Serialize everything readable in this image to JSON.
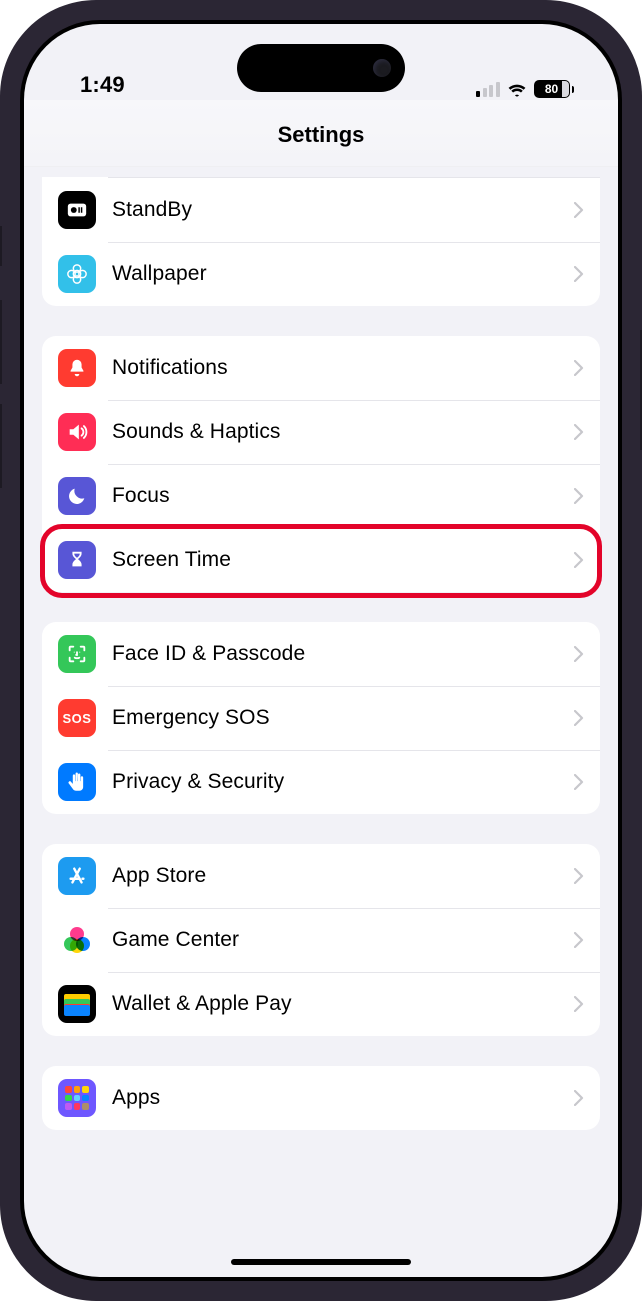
{
  "status": {
    "time": "1:49",
    "battery_pct": "80"
  },
  "nav": {
    "title": "Settings"
  },
  "groups": [
    {
      "id": "g0",
      "partial_top": true,
      "rows": [
        {
          "icon": "standby",
          "label": "StandBy"
        },
        {
          "icon": "wallpaper",
          "label": "Wallpaper"
        }
      ]
    },
    {
      "id": "g1",
      "rows": [
        {
          "icon": "notif",
          "label": "Notifications"
        },
        {
          "icon": "sounds",
          "label": "Sounds & Haptics"
        },
        {
          "icon": "focus",
          "label": "Focus"
        },
        {
          "icon": "screentime",
          "label": "Screen Time",
          "highlight": true
        }
      ]
    },
    {
      "id": "g2",
      "rows": [
        {
          "icon": "faceid",
          "label": "Face ID & Passcode"
        },
        {
          "icon": "sos",
          "label": "Emergency SOS"
        },
        {
          "icon": "privacy",
          "label": "Privacy & Security"
        }
      ]
    },
    {
      "id": "g3",
      "rows": [
        {
          "icon": "appstore",
          "label": "App Store"
        },
        {
          "icon": "gamecenter",
          "label": "Game Center"
        },
        {
          "icon": "wallet",
          "label": "Wallet & Apple Pay"
        }
      ]
    },
    {
      "id": "g4",
      "rows": [
        {
          "icon": "apps",
          "label": "Apps"
        }
      ]
    }
  ],
  "highlight_color": "#e3042a"
}
